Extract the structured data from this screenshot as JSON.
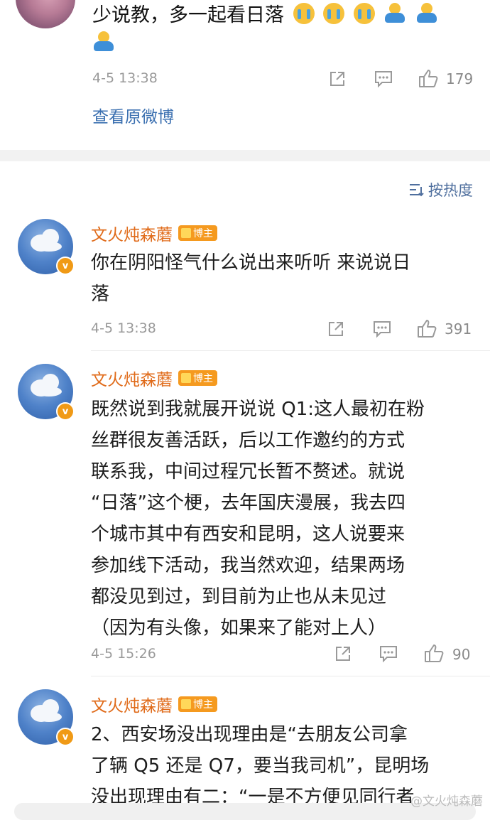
{
  "top_comment": {
    "text": "少说教，多一起看日落",
    "time": "4-5 13:38",
    "likes": "179",
    "view_original": "查看原微博"
  },
  "sort": {
    "label": "按热度"
  },
  "comments": [
    {
      "author": "文火炖森蘑",
      "tag": "博主",
      "lines": [
        "你在阴阳怪气什么说出来听听 来说说日",
        "落"
      ],
      "time": "4-5 13:38",
      "likes": "391"
    },
    {
      "author": "文火炖森蘑",
      "tag": "博主",
      "lines": [
        "既然说到我就展开说说 Q1:这人最初在粉",
        "丝群很友善活跃，后以工作邀约的方式",
        "联系我，中间过程冗长暂不赘述。就说",
        "“日落”这个梗，去年国庆漫展，我去四",
        "个城市其中有西安和昆明，这人说要来",
        "参加线下活动，我当然欢迎，结果两场",
        "都没见到过，到目前为止也从未见过",
        "（因为有头像，如果来了能对上人）"
      ],
      "time": "4-5 15:26",
      "likes": "90"
    },
    {
      "author": "文火炖森蘑",
      "tag": "博主",
      "lines": [
        "2、西安场没出现理由是“去朋友公司拿",
        "了辆 Q5 还是 Q7，要当我司机”，昆明场",
        "没出现理由有二：“一是不方便见同行者"
      ]
    }
  ],
  "watermark": "@文火炖森蘑",
  "colors": {
    "name": "#e06b1a",
    "link": "#3a6fb0",
    "meta": "#9a9a9a",
    "tag": "#f59a1f"
  }
}
